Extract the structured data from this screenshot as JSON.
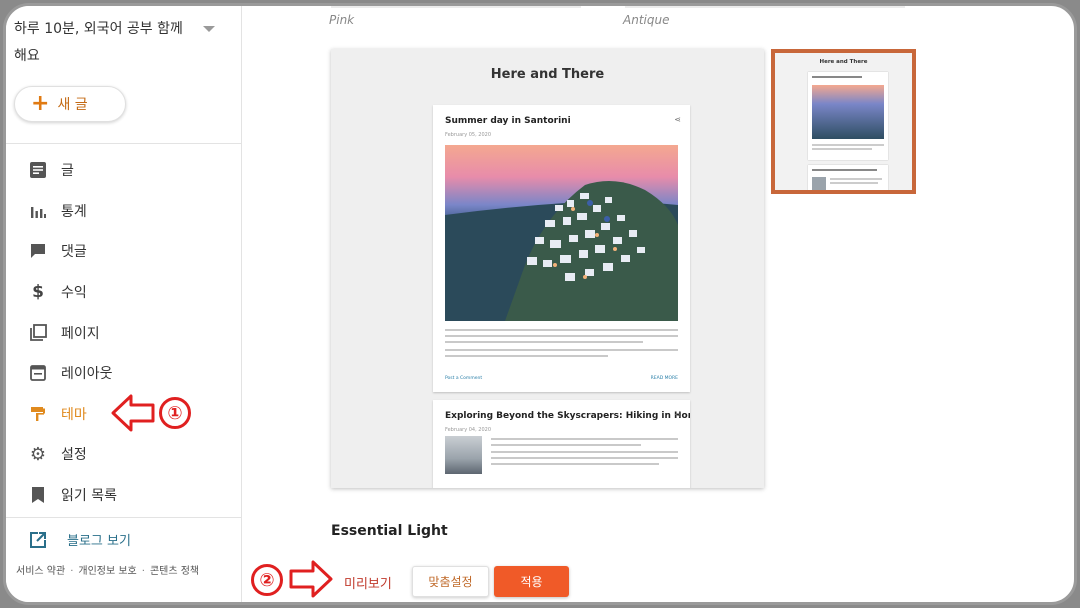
{
  "sidebar": {
    "blog_title": "하루 10분, 외국어 공부 함께 해요",
    "new_post_label": "새 글",
    "items": [
      {
        "label": "글",
        "icon": "posts-icon"
      },
      {
        "label": "통계",
        "icon": "stats-icon"
      },
      {
        "label": "댓글",
        "icon": "comments-icon"
      },
      {
        "label": "수익",
        "icon": "dollar-icon"
      },
      {
        "label": "페이지",
        "icon": "pages-icon"
      },
      {
        "label": "레이아웃",
        "icon": "layout-icon"
      },
      {
        "label": "테마",
        "icon": "paint-roller-icon",
        "active": true
      },
      {
        "label": "설정",
        "icon": "gear-icon"
      },
      {
        "label": "읽기 목록",
        "icon": "bookmark-icon"
      }
    ],
    "view_blog_label": "블로그 보기",
    "footer": {
      "terms": "서비스 약관",
      "privacy": "개인정보 보호",
      "content_policy": "콘텐츠 정책",
      "sep": "·"
    }
  },
  "main": {
    "top_themes": [
      "Pink",
      "Antique"
    ],
    "preview": {
      "blog_heading": "Here and There",
      "post1_title": "Summer day in Santorini",
      "post1_date": "February 05, 2020",
      "post1_text": "I had always wanted to go to Greece, and when I finally went, it was better than I could have imagined. The first part of my trip was to Santorini, and the island's beauty was breathtaking. If you're lucky enough to find yourself on the small dot in the Aegean Sea, here are some fun activities to make your trip memorable:",
      "post1_item": "1. Visit a volcano. Take a quick boat cruise to Nea Kameni, an uninhabited island just off the coast of Santorini.",
      "post_comment": "Post a Comment",
      "read_more": "READ MORE",
      "post2_title": "Exploring Beyond the Skyscrapers: Hiking in Hong Kong",
      "post2_date": "February 04, 2020",
      "post2_text": "When people think about Hong Kong, they often picture a megalopolis with endless skyscrapers. When I think of Hong Kong, I picture something totally different – nature! On a recent trip to the island, I learned that the Hong Kong is a true hiker's paradise, with four major hiking trails and many other ones, too. The four major trails are The Hong Kong Trail."
    },
    "theme_name": "Essential Light",
    "buttons": {
      "preview": "미리보기",
      "customize": "맞춤설정",
      "apply": "적용"
    }
  },
  "annotations": {
    "one": "①",
    "two": "②"
  },
  "colors": {
    "accent": "#e08a1e",
    "apply": "#f05a28",
    "annotation": "#e02020",
    "selected_border": "#c8673a"
  }
}
